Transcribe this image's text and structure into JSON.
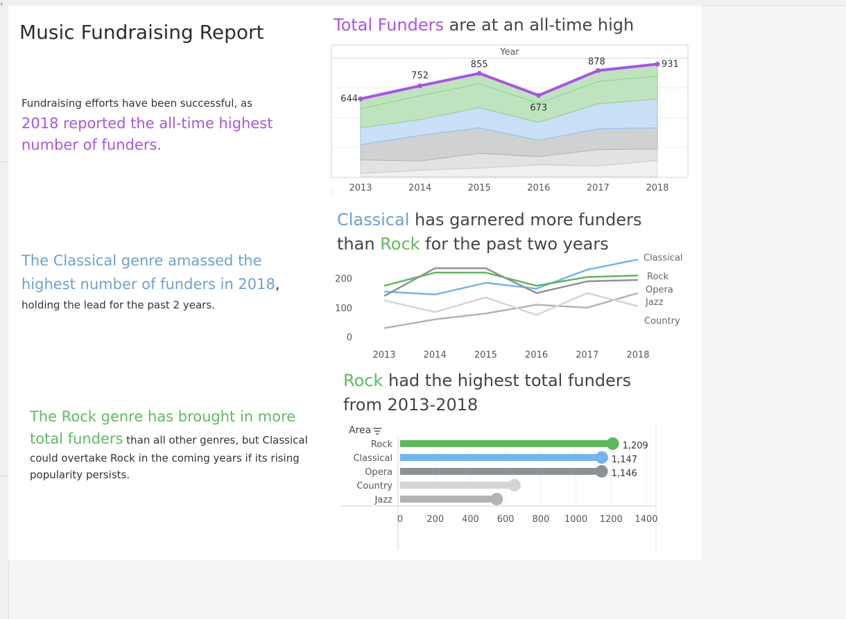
{
  "page": {
    "title": "Music Fundraising Report",
    "note1_plain": "Fundraising efforts have been successful, as",
    "note1_highlight": "2018 reported the all-time highest number of funders.",
    "note2_highlight_a": "The Classical genre amassed the highest number of funders in 2018",
    "note2_comma": ",",
    "note2_plain": "holding the lead for the past 2 years.",
    "note3_highlight_a": "The Rock genre has brought in more",
    "note3_highlight_b": "total funders",
    "note3_plain": " than all other genres, but Classical could overtake Rock in the coming years if its rising popularity persists."
  },
  "chart1_title": {
    "accent": "Total Funders",
    "rest": " are at an all-time high"
  },
  "chart2_title": {
    "accent1": "Classical",
    "mid": " has garnered more funders than ",
    "accent2": "Rock",
    "rest": " for the past two years"
  },
  "chart3_title": {
    "accent": "Rock",
    "rest": " had the highest total funders from 2013-2018"
  },
  "colors": {
    "purple": "#a855e0",
    "classical": "#74b4ec",
    "rock": "#5cb85c",
    "opera": "#8c9196",
    "jazz": "#b3b3b3",
    "country": "#d4d4d4"
  },
  "chart_data": [
    {
      "type": "area",
      "column_header": "Year",
      "x": [
        "2013",
        "2014",
        "2015",
        "2016",
        "2017",
        "2018"
      ],
      "total": [
        644,
        752,
        855,
        673,
        878,
        931
      ],
      "total_labels": [
        "644",
        "752",
        "855",
        "673",
        "878",
        "931"
      ],
      "series": [
        {
          "name": "Jazz",
          "values": [
            30,
            60,
            80,
            110,
            100,
            150
          ]
        },
        {
          "name": "Country",
          "values": [
            125,
            85,
            135,
            75,
            150,
            105
          ]
        },
        {
          "name": "Opera",
          "values": [
            140,
            235,
            235,
            150,
            190,
            195
          ]
        },
        {
          "name": "Classical",
          "values": [
            155,
            145,
            185,
            165,
            230,
            265
          ]
        },
        {
          "name": "Rock",
          "values": [
            175,
            220,
            220,
            175,
            205,
            210
          ]
        }
      ],
      "ylim": [
        0,
        980
      ]
    },
    {
      "type": "line",
      "x": [
        "2013",
        "2014",
        "2015",
        "2016",
        "2017",
        "2018"
      ],
      "y_ticks": [
        "200",
        "100",
        "0"
      ],
      "ylim": [
        0,
        280
      ],
      "series": [
        {
          "name": "Classical",
          "values": [
            155,
            145,
            185,
            165,
            230,
            265
          ]
        },
        {
          "name": "Rock",
          "values": [
            175,
            220,
            220,
            175,
            205,
            210
          ]
        },
        {
          "name": "Opera",
          "values": [
            140,
            235,
            235,
            150,
            190,
            195
          ]
        },
        {
          "name": "Jazz",
          "values": [
            30,
            60,
            80,
            110,
            100,
            150
          ]
        },
        {
          "name": "Country",
          "values": [
            125,
            85,
            135,
            75,
            150,
            105
          ]
        }
      ]
    },
    {
      "type": "bar",
      "orientation": "horizontal",
      "axis_header": "Area",
      "categories": [
        "Rock",
        "Classical",
        "Opera",
        "Country",
        "Jazz"
      ],
      "values": [
        1209,
        1147,
        1146,
        650,
        550
      ],
      "value_labels": [
        "1,209",
        "1,147",
        "1,146",
        "",
        ""
      ],
      "x_ticks": [
        "0",
        "200",
        "400",
        "600",
        "800",
        "1000",
        "1200",
        "1400"
      ],
      "xlim": [
        0,
        1400
      ]
    }
  ]
}
